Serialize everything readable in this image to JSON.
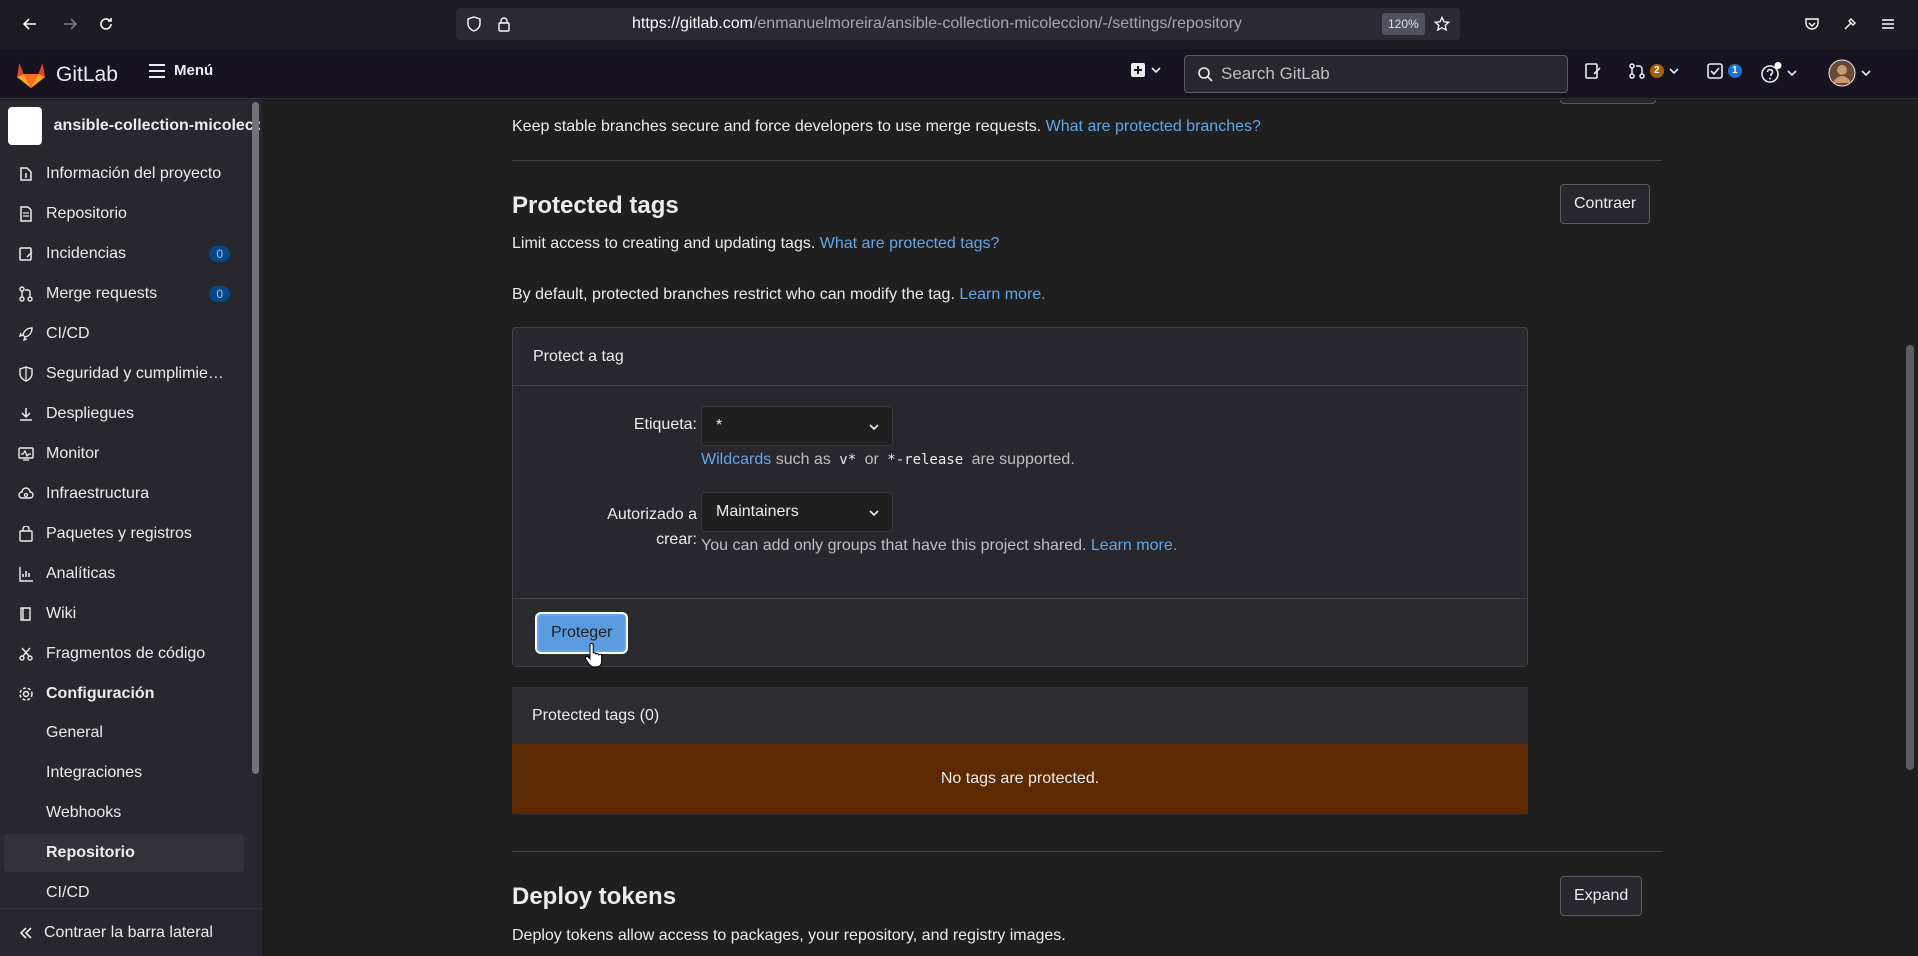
{
  "browser": {
    "url_host": "https://gitlab.com",
    "url_path": "/enmanuelmoreira/ansible-collection-micoleccion/-/settings/repository",
    "zoom": "120%"
  },
  "header": {
    "logo_text": "GitLab",
    "menu_label": "Menú",
    "search_placeholder": "Search GitLab",
    "mr_count": "2",
    "todo_count": "1"
  },
  "sidebar": {
    "project_name": "ansible-collection-micoleccion",
    "items": [
      {
        "label": "Información del proyecto",
        "icon": "project-info-icon"
      },
      {
        "label": "Repositorio",
        "icon": "repository-icon"
      },
      {
        "label": "Incidencias",
        "icon": "issues-icon",
        "count": "0"
      },
      {
        "label": "Merge requests",
        "icon": "merge-request-icon",
        "count": "0"
      },
      {
        "label": "CI/CD",
        "icon": "rocket-icon"
      },
      {
        "label": "Seguridad y cumplimiento",
        "icon": "shield-icon"
      },
      {
        "label": "Despliegues",
        "icon": "deployments-icon"
      },
      {
        "label": "Monitor",
        "icon": "monitor-icon"
      },
      {
        "label": "Infraestructura",
        "icon": "cloud-gear-icon"
      },
      {
        "label": "Paquetes y registros",
        "icon": "package-icon"
      },
      {
        "label": "Analíticas",
        "icon": "chart-icon"
      },
      {
        "label": "Wiki",
        "icon": "book-icon"
      },
      {
        "label": "Fragmentos de código",
        "icon": "snippet-icon"
      },
      {
        "label": "Configuración",
        "icon": "settings-icon"
      }
    ],
    "sub_items": [
      "General",
      "Integraciones",
      "Webhooks",
      "Repositorio",
      "CI/CD"
    ],
    "collapse_label": "Contraer la barra lateral"
  },
  "main": {
    "top_desc": "Keep stable branches secure and force developers to use merge requests.",
    "top_link": "What are protected branches?",
    "protected_tags": {
      "title": "Protected tags",
      "toggle_label": "Contraer",
      "desc": "Limit access to creating and updating tags.",
      "desc_link": "What are protected tags?",
      "default_note": "By default, protected branches restrict who can modify the tag.",
      "default_link": "Learn more.",
      "form": {
        "heading": "Protect a tag",
        "tag_label": "Etiqueta:",
        "tag_value": "*",
        "wildcards_link": "Wildcards",
        "wildcards_text_1": "such as",
        "wildcards_code_1": "v*",
        "wildcards_text_2": "or",
        "wildcards_code_2": "*-release",
        "wildcards_text_3": "are supported.",
        "allowed_label_1": "Autorizado a",
        "allowed_label_2": "crear:",
        "allowed_value": "Maintainers",
        "allowed_help": "You can add only groups that have this project shared.",
        "allowed_help_link": "Learn more.",
        "submit_label": "Proteger"
      },
      "list_heading": "Protected tags (0)",
      "empty_message": "No tags are protected."
    },
    "deploy_tokens": {
      "title": "Deploy tokens",
      "toggle_label": "Expand",
      "desc": "Deploy tokens allow access to packages, your repository, and registry images."
    }
  }
}
